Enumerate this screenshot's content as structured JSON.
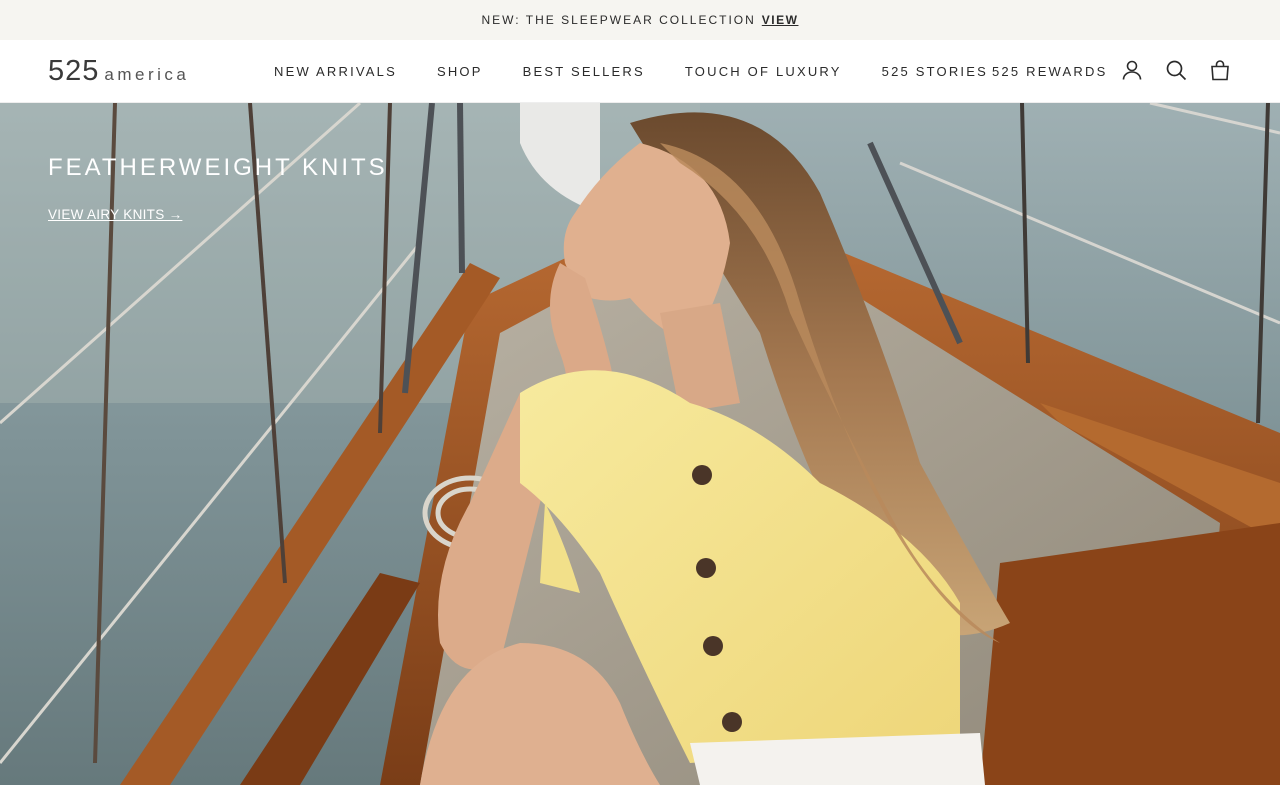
{
  "announcement": {
    "text": "NEW: THE SLEEPWEAR COLLECTION",
    "link_label": "VIEW"
  },
  "header": {
    "logo_number": "525",
    "logo_word": "america",
    "nav": [
      {
        "label": "NEW ARRIVALS"
      },
      {
        "label": "SHOP"
      },
      {
        "label": "BEST SELLERS"
      },
      {
        "label": "TOUCH OF LUXURY"
      },
      {
        "label": "525 STORIES"
      }
    ],
    "rewards_label": "525 REWARDS",
    "icons": [
      "account-icon",
      "search-icon",
      "bag-icon"
    ]
  },
  "hero": {
    "title": "FEATHERWEIGHT KNITS",
    "cta_label": "VIEW AIRY KNITS →"
  },
  "colors": {
    "announcement_bg": "#f6f5f1",
    "text": "#2b2b2b",
    "hero_text": "#ffffff",
    "sweater": "#f5e28a",
    "wood": "#9c5424"
  }
}
